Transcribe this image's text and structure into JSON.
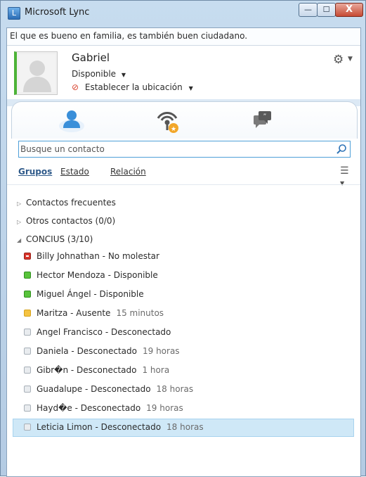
{
  "window": {
    "title": "Microsoft Lync",
    "app_icon_letter": "L",
    "controls": {
      "minimize": "—",
      "maximize": "☐",
      "close": "X"
    }
  },
  "note": "El que es bueno en familia, es también buen ciudadano.",
  "profile": {
    "name": "Gabriel",
    "status": "Disponible",
    "location": "Establecer la ubicación"
  },
  "tabs": [
    {
      "icon": "contacts-icon"
    },
    {
      "icon": "presence-icon"
    },
    {
      "icon": "conversations-icon"
    }
  ],
  "search": {
    "placeholder": "Busque un contacto"
  },
  "view_tabs": {
    "groups": "Grupos",
    "status": "Estado",
    "relation": "Relación"
  },
  "groups": {
    "frequent": "Contactos frecuentes",
    "others": "Otros  contactos (0/0)",
    "concius": "CONCIUS (3/10)"
  },
  "contacts": [
    {
      "name": "Billy Johnathan - No molestar",
      "time": "",
      "status": "busy"
    },
    {
      "name": "Hector Mendoza - Disponible",
      "time": "",
      "status": "available"
    },
    {
      "name": "Miguel Ángel - Disponible",
      "time": "",
      "status": "available"
    },
    {
      "name": "Maritza - Ausente",
      "time": "15 minutos",
      "status": "away"
    },
    {
      "name": "Angel Francisco - Desconectado",
      "time": "",
      "status": "offline"
    },
    {
      "name": "Daniela - Desconectado",
      "time": "19 horas",
      "status": "offline"
    },
    {
      "name": "Gibr�n - Desconectado",
      "time": "1 hora",
      "status": "offline"
    },
    {
      "name": "Guadalupe - Desconectado",
      "time": "18 horas",
      "status": "offline"
    },
    {
      "name": "Hayd�e - Desconectado",
      "time": "19 horas",
      "status": "offline"
    },
    {
      "name": "Leticia Limon - Desconectado",
      "time": "18 horas",
      "status": "offline",
      "selected": true
    }
  ],
  "colors": {
    "available": "#58c33b",
    "busy": "#d7352b",
    "away": "#f5c342",
    "offline": "#e9ecef",
    "accent": "#4ea0d8",
    "selection": "#cfe8f7"
  }
}
